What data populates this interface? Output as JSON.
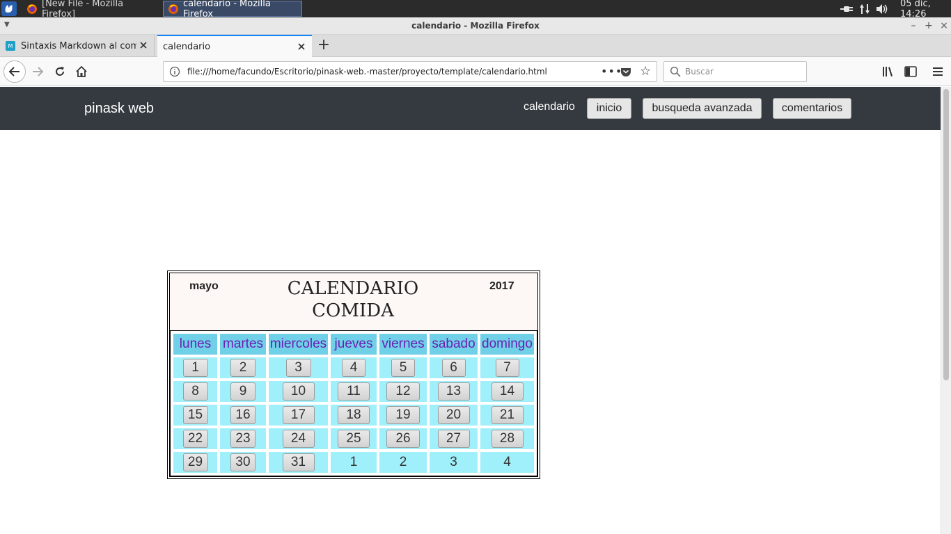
{
  "os_panel": {
    "tasks": [
      {
        "label": "[New File - Mozilla Firefox]"
      },
      {
        "label": "calendario - Mozilla Firefox"
      }
    ],
    "clock": "05 dic, 14:26"
  },
  "window": {
    "title": "calendario - Mozilla Firefox"
  },
  "tabs": [
    {
      "label": "Sintaxis Markdown al completo"
    },
    {
      "label": "calendario"
    }
  ],
  "toolbar": {
    "url": "file:///home/facundo/Escritorio/pinask-web.-master/proyecto/template/calendario.html",
    "search_placeholder": "Buscar"
  },
  "site": {
    "brand": "pinask web",
    "nav_link": "calendario",
    "buttons": [
      "inicio",
      "busqueda avanzada",
      "comentarios"
    ]
  },
  "calendar": {
    "month": "mayo",
    "year": "2017",
    "title_line1": "CALENDARIO",
    "title_line2": "COMIDA",
    "weekdays": [
      "lunes",
      "martes",
      "miercoles",
      "jueves",
      "viernes",
      "sabado",
      "domingo"
    ],
    "weeks": [
      [
        {
          "d": "1",
          "btn": true
        },
        {
          "d": "2",
          "btn": true
        },
        {
          "d": "3",
          "btn": true
        },
        {
          "d": "4",
          "btn": true
        },
        {
          "d": "5",
          "btn": true
        },
        {
          "d": "6",
          "btn": true
        },
        {
          "d": "7",
          "btn": true
        }
      ],
      [
        {
          "d": "8",
          "btn": true
        },
        {
          "d": "9",
          "btn": true
        },
        {
          "d": "10",
          "btn": true
        },
        {
          "d": "11",
          "btn": true
        },
        {
          "d": "12",
          "btn": true
        },
        {
          "d": "13",
          "btn": true
        },
        {
          "d": "14",
          "btn": true
        }
      ],
      [
        {
          "d": "15",
          "btn": true
        },
        {
          "d": "16",
          "btn": true
        },
        {
          "d": "17",
          "btn": true
        },
        {
          "d": "18",
          "btn": true
        },
        {
          "d": "19",
          "btn": true
        },
        {
          "d": "20",
          "btn": true
        },
        {
          "d": "21",
          "btn": true
        }
      ],
      [
        {
          "d": "22",
          "btn": true
        },
        {
          "d": "23",
          "btn": true
        },
        {
          "d": "24",
          "btn": true
        },
        {
          "d": "25",
          "btn": true
        },
        {
          "d": "26",
          "btn": true
        },
        {
          "d": "27",
          "btn": true
        },
        {
          "d": "28",
          "btn": true
        }
      ],
      [
        {
          "d": "29",
          "btn": true
        },
        {
          "d": "30",
          "btn": true
        },
        {
          "d": "31",
          "btn": true
        },
        {
          "d": "1",
          "btn": false
        },
        {
          "d": "2",
          "btn": false
        },
        {
          "d": "3",
          "btn": false
        },
        {
          "d": "4",
          "btn": false
        }
      ]
    ]
  }
}
